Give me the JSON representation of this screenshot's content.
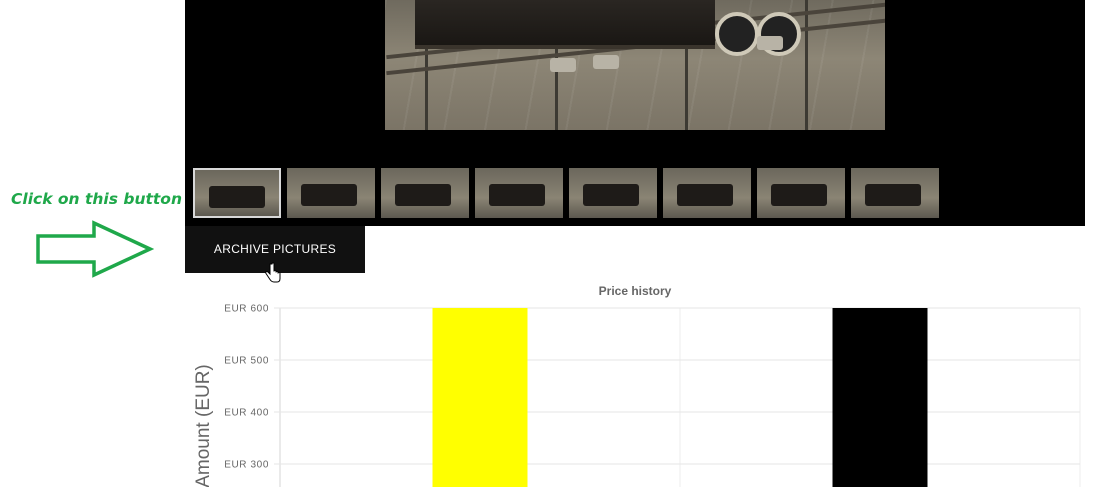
{
  "annotation": {
    "callout_text": "Click on this button",
    "arrow_color": "#1fa84a"
  },
  "gallery": {
    "main_image": "model steam locomotive on wooden planks",
    "thumbnails": [
      {
        "subject": "locomotive side view",
        "active": true
      },
      {
        "subject": "locomotive and tender"
      },
      {
        "subject": "smokebox front"
      },
      {
        "subject": "locomotive underside"
      },
      {
        "subject": "locomotive top view"
      },
      {
        "subject": "locomotive three-quarter view"
      },
      {
        "subject": "chimney close-up"
      },
      {
        "subject": "chassis and wheels"
      }
    ]
  },
  "archive_button": {
    "label": "ARCHIVE PICTURES"
  },
  "chart_data": {
    "type": "bar",
    "title": "Price history",
    "ylabel": "Amount (EUR)",
    "ylim": [
      250,
      600
    ],
    "yticks": [
      "EUR 600",
      "EUR 500",
      "EUR 400",
      "EUR 300"
    ],
    "ytick_values": [
      600,
      500,
      400,
      300
    ],
    "grid": true,
    "categories": [
      "",
      ""
    ],
    "values": [
      600,
      600
    ],
    "colors": [
      "#ffff00",
      "#000000"
    ]
  }
}
